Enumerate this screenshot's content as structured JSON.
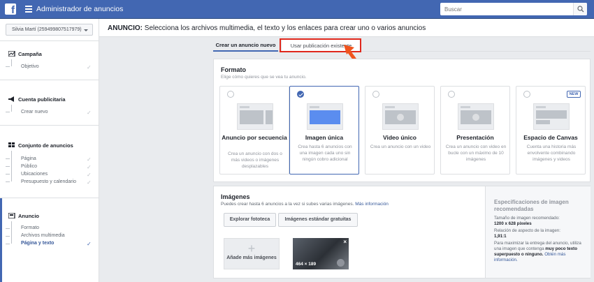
{
  "app": {
    "title": "Administrador de anuncios",
    "search_placeholder": "Buscar"
  },
  "account": {
    "label": "Silvia Martí (259499807517979)"
  },
  "sidebar": {
    "sections": [
      {
        "title": "Campaña",
        "items": [
          "Objetivo"
        ]
      },
      {
        "title": "Cuenta publicitaria",
        "items": [
          "Crear nuevo"
        ]
      },
      {
        "title": "Conjunto de anuncios",
        "items": [
          "Página",
          "Público",
          "Ubicaciones",
          "Presupuesto y calendario"
        ]
      },
      {
        "title": "Anuncio",
        "items": [
          "Formato",
          "Archivos multimedia",
          "Página y texto"
        ]
      }
    ]
  },
  "header": {
    "bold": "ANUNCIO:",
    "text": " Selecciona los archivos multimedia, el texto y los enlaces para crear uno o varios anuncios"
  },
  "tabs": {
    "new": "Crear un anuncio nuevo",
    "existing": "Usar publicación existente"
  },
  "format": {
    "title": "Formato",
    "subtitle": "Elige cómo quieres que se vea tu anuncio.",
    "cards": [
      {
        "title": "Anuncio por secuencia",
        "desc": "Crea un anuncio con dos o más videos o imágenes desplazables"
      },
      {
        "title": "Imagen única",
        "desc": "Crea hasta 6 anuncios con una imagen cada uno sin ningún cobro adicional"
      },
      {
        "title": "Video único",
        "desc": "Crea un anuncio con un video"
      },
      {
        "title": "Presentación",
        "desc": "Crea un anuncio con video en bucle con un máximo de 10 imágenes"
      },
      {
        "title": "Espacio de Canvas",
        "desc": "Cuenta una historia más envolvente combinando imágenes y videos",
        "badge": "NEW"
      }
    ]
  },
  "images": {
    "title": "Imágenes",
    "desc": "Puedes crear hasta 6 anuncios a la vez si subes varias imágenes.",
    "more_link": "Más información",
    "btn_library": "Explorar fototeca",
    "btn_stock": "Imágenes estándar gratuitas",
    "add_label": "Añade más imágenes",
    "thumb_size": "464 × 189",
    "thumb_close": "×"
  },
  "specs": {
    "title": "Especificaciones de imagen recomendadas",
    "size_label": "Tamaño de imagen recomendado:",
    "size_value": "1200 x 628 píxeles",
    "ratio_label": "Relación de aspecto de la imagen:",
    "ratio_value": "1,91:1",
    "tip_a": "Para maximizar la entrega del anuncio, utiliza una imagen que contenga",
    "tip_bold": "muy poco texto superpuesto o ninguno.",
    "tip_link": "Obtén más información."
  }
}
